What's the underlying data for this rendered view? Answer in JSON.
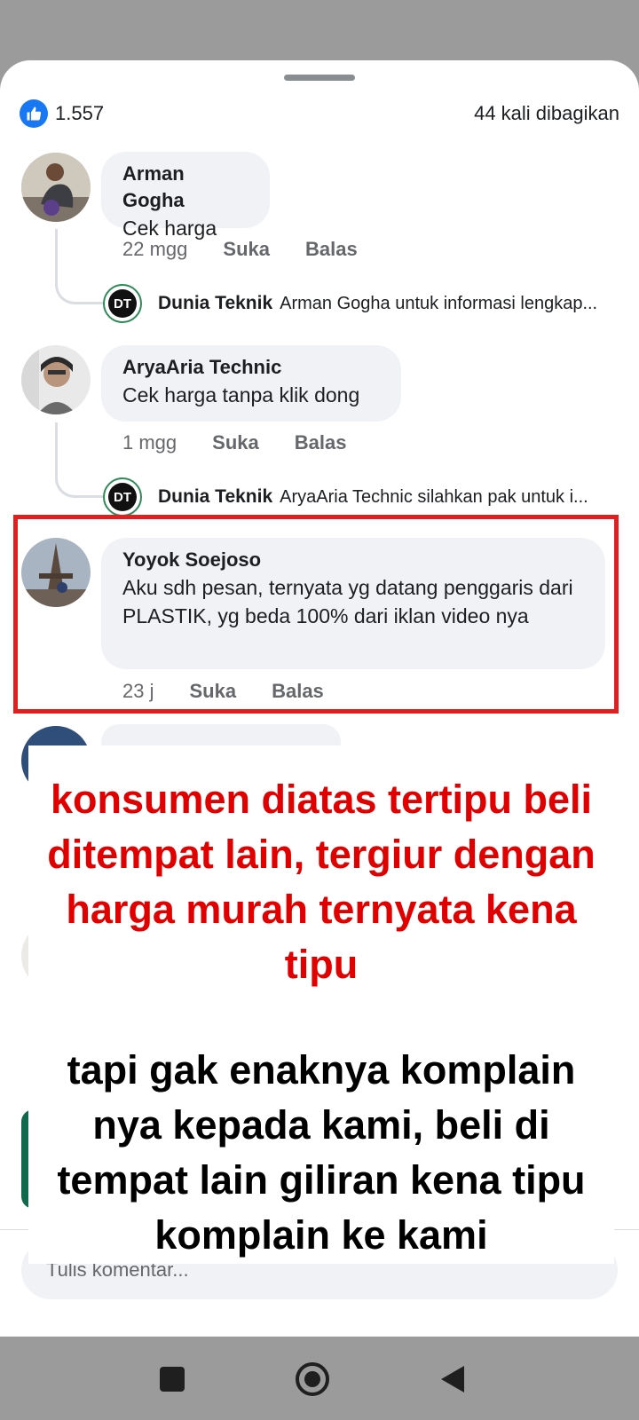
{
  "reactions": {
    "like_count": "1.557",
    "shares": "44 kali dibagikan"
  },
  "comments": [
    {
      "author": "Arman Gogha",
      "text": "Cek harga",
      "time": "22 mgg",
      "like": "Suka",
      "reply": "Balas",
      "reply_preview": {
        "author": "Dunia Teknik",
        "avatar_initials": "DT",
        "text": "Arman Gogha untuk informasi lengkap..."
      }
    },
    {
      "author": "AryaAria Technic",
      "text": "Cek harga tanpa klik dong",
      "time": "1 mgg",
      "like": "Suka",
      "reply": "Balas",
      "reply_preview": {
        "author": "Dunia Teknik",
        "avatar_initials": "DT",
        "text": "AryaAria Technic silahkan pak untuk i..."
      }
    },
    {
      "author": "Yoyok Soejoso",
      "text": "Aku sdh pesan, ternyata yg datang penggaris dari PLASTIK, yg beda 100% dari iklan video nya",
      "time": "23 j",
      "like": "Suka",
      "reply": "Balas"
    }
  ],
  "annotation": {
    "red": "konsumen diatas tertipu beli ditempat lain, tergiur dengan harga murah ternyata kena tipu",
    "black": "tapi gak enaknya komplain nya kepada kami, beli di tempat lain giliran kena tipu komplain ke kami"
  },
  "composer": {
    "placeholder": "Tulis komentar..."
  },
  "colors": {
    "accent": "#1877f2",
    "highlight": "#e02020",
    "note_red": "#e00000",
    "bubble": "#f0f2f5"
  },
  "icons": {
    "like": "like-icon",
    "nav_back": "back-triangle-icon",
    "nav_home": "home-circle-icon",
    "nav_recent": "recent-square-icon"
  }
}
